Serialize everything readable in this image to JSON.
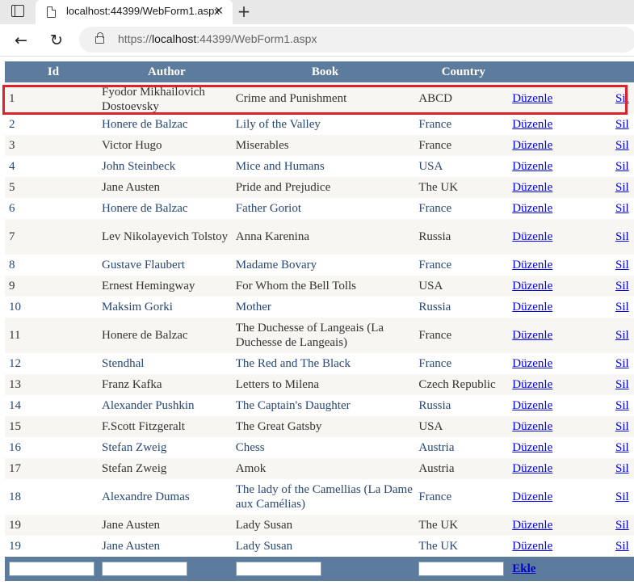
{
  "browser": {
    "tab_title": "localhost:44399/WebForm1.aspx",
    "close_glyph": "✕",
    "new_tab_glyph": "+",
    "back_glyph": "←",
    "reload_glyph": "↻",
    "url_prefix": "https://",
    "url_host": "localhost",
    "url_rest": ":44399/WebForm1.aspx"
  },
  "grid": {
    "headers": [
      "Id",
      "Author",
      "Book",
      "Country",
      "",
      ""
    ],
    "edit_label": "Düzenle",
    "delete_label": "Sil",
    "add_label": "Ekle",
    "rows": [
      {
        "id": "1",
        "author": "Fyodor Mikhailovich Dostoevsky",
        "book": "Crime and Punishment",
        "country": "ABCD"
      },
      {
        "id": "2",
        "author": "Honere de Balzac",
        "book": "Lily of the Valley",
        "country": "France"
      },
      {
        "id": "3",
        "author": "Victor Hugo",
        "book": "Miserables",
        "country": "France"
      },
      {
        "id": "4",
        "author": "John Steinbeck",
        "book": "Mice and Humans",
        "country": "USA"
      },
      {
        "id": "5",
        "author": "Jane Austen",
        "book": "Pride and Prejudice",
        "country": "The UK"
      },
      {
        "id": "6",
        "author": "Honere de Balzac",
        "book": "Father Goriot",
        "country": "France"
      },
      {
        "id": "7",
        "author": "Lev Nikolayevich Tolstoy",
        "book": "Anna Karenina",
        "country": "Russia"
      },
      {
        "id": "8",
        "author": "Gustave Flaubert",
        "book": "Madame Bovary",
        "country": "France"
      },
      {
        "id": "9",
        "author": "Ernest Hemingway",
        "book": "For Whom the Bell Tolls",
        "country": "USA"
      },
      {
        "id": "10",
        "author": "Maksim Gorki",
        "book": "Mother",
        "country": "Russia"
      },
      {
        "id": "11",
        "author": "Honere de Balzac",
        "book": "The Duchesse of Langeais (La Duchesse de Langeais)",
        "country": "France"
      },
      {
        "id": "12",
        "author": "Stendhal",
        "book": "The Red and The Black",
        "country": "France"
      },
      {
        "id": "13",
        "author": "Franz Kafka",
        "book": "Letters to Milena",
        "country": "Czech Republic"
      },
      {
        "id": "14",
        "author": "Alexander Pushkin",
        "book": "The Captain's Daughter",
        "country": "Russia"
      },
      {
        "id": "15",
        "author": "F.Scott Fitzgeralt",
        "book": "The Great Gatsby",
        "country": "USA"
      },
      {
        "id": "16",
        "author": "Stefan Zweig",
        "book": "Chess",
        "country": "Austria"
      },
      {
        "id": "17",
        "author": "Stefan Zweig",
        "book": "Amok",
        "country": "Austria"
      },
      {
        "id": "18",
        "author": "Alexandre Dumas",
        "book": "The lady of the Camellias (La Dame aux Camélias)",
        "country": "France"
      },
      {
        "id": "19",
        "author": "Jane Austen",
        "book": "Lady Susan",
        "country": "The UK"
      },
      {
        "id": "19",
        "author": "Jane Austen",
        "book": "Lady Susan",
        "country": "The UK"
      }
    ]
  },
  "colors": {
    "header_bg": "#5d7b9d",
    "row_odd_bg": "#f7f6f3",
    "row_even_text": "#284775",
    "highlight_border": "#e0202a"
  }
}
